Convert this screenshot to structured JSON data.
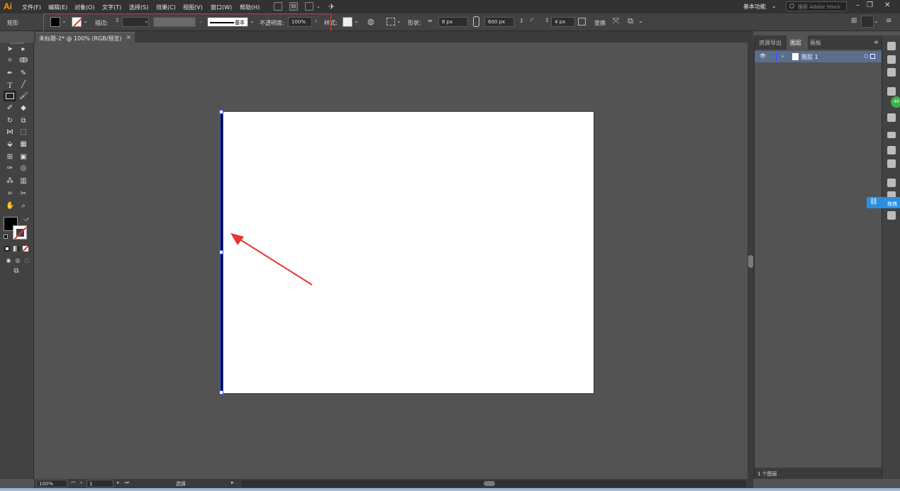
{
  "app": {
    "logo": "Ai"
  },
  "menu": {
    "items": [
      "文件(F)",
      "编辑(E)",
      "对象(O)",
      "文字(T)",
      "选择(S)",
      "效果(C)",
      "视图(V)",
      "窗口(W)",
      "帮助(H)"
    ],
    "st_label": "St",
    "workspace": "基本功能",
    "search_placeholder": "搜索 Adobe Stock"
  },
  "control": {
    "tool_name": "矩形",
    "stroke_label": "描边:",
    "stroke_style": "基本",
    "opacity_label": "不透明度:",
    "opacity_value": "100%",
    "style_label": "样式:",
    "shape_label": "形状:",
    "width_value": "8 px",
    "height_value": "600 px",
    "corner_value": "4 px",
    "transform_label": "变换"
  },
  "document": {
    "tab_title": "未标题-2* @ 100% (RGB/预览)",
    "close": "×"
  },
  "panel": {
    "tabs": [
      "资源导出",
      "图层",
      "画板"
    ],
    "layer_name": "图层 1",
    "layer_count": "1 个图层"
  },
  "sidebar_badge": {
    "label": "拖拽",
    "count": "46"
  },
  "status": {
    "zoom": "100%",
    "artboard_num": "1",
    "mode": "选择"
  },
  "colors": {
    "accent": "#3c57ff",
    "logo": "#ff9a00",
    "highlight": "#e0352b",
    "arrow": "#e8352f"
  }
}
